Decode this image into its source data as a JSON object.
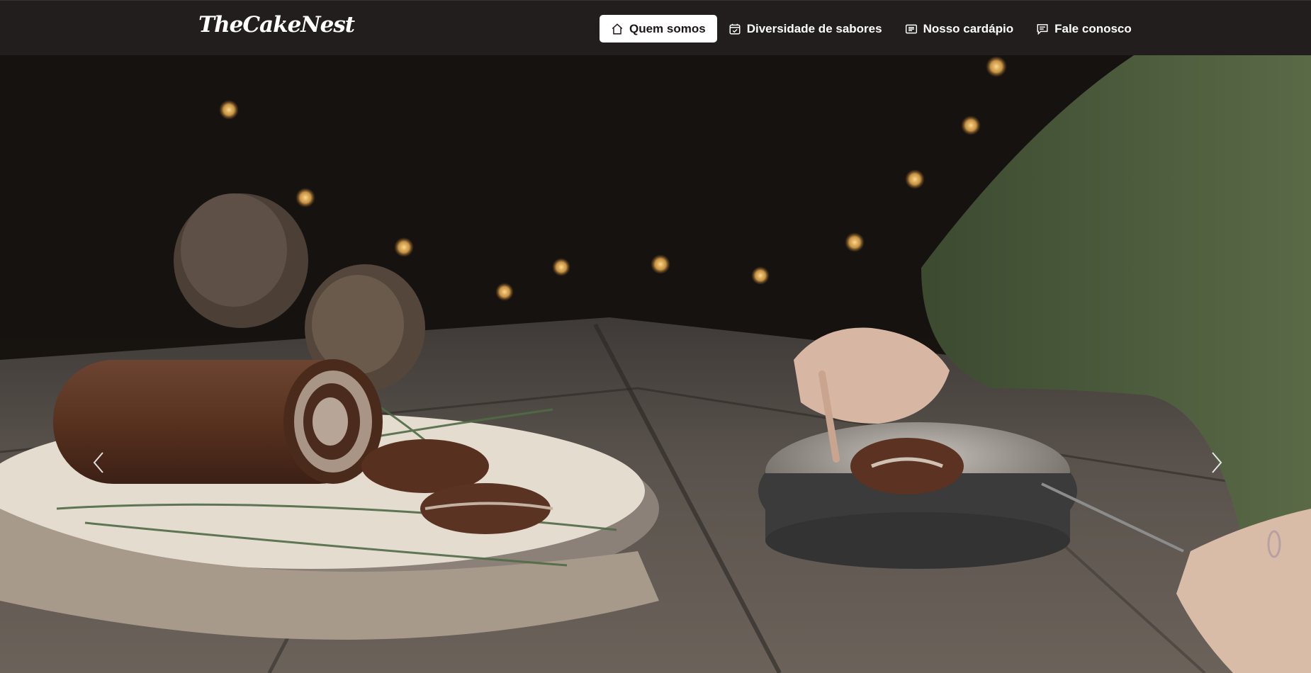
{
  "brand": {
    "name": "TheCakeNest"
  },
  "nav": {
    "items": [
      {
        "label": "Quem somos",
        "icon": "home-icon",
        "active": true
      },
      {
        "label": "Diversidade de sabores",
        "icon": "calendar-check-icon",
        "active": false
      },
      {
        "label": "Nosso cardápio",
        "icon": "card-list-icon",
        "active": false
      },
      {
        "label": "Fale conosco",
        "icon": "chat-text-icon",
        "active": false
      }
    ]
  },
  "carousel": {
    "prev_icon": "chevron-left-icon",
    "next_icon": "chevron-right-icon",
    "image": "chocolate-swiss-roll-photo"
  },
  "colors": {
    "navbar_bg": "#231e1e",
    "active_bg": "#ffffff"
  }
}
